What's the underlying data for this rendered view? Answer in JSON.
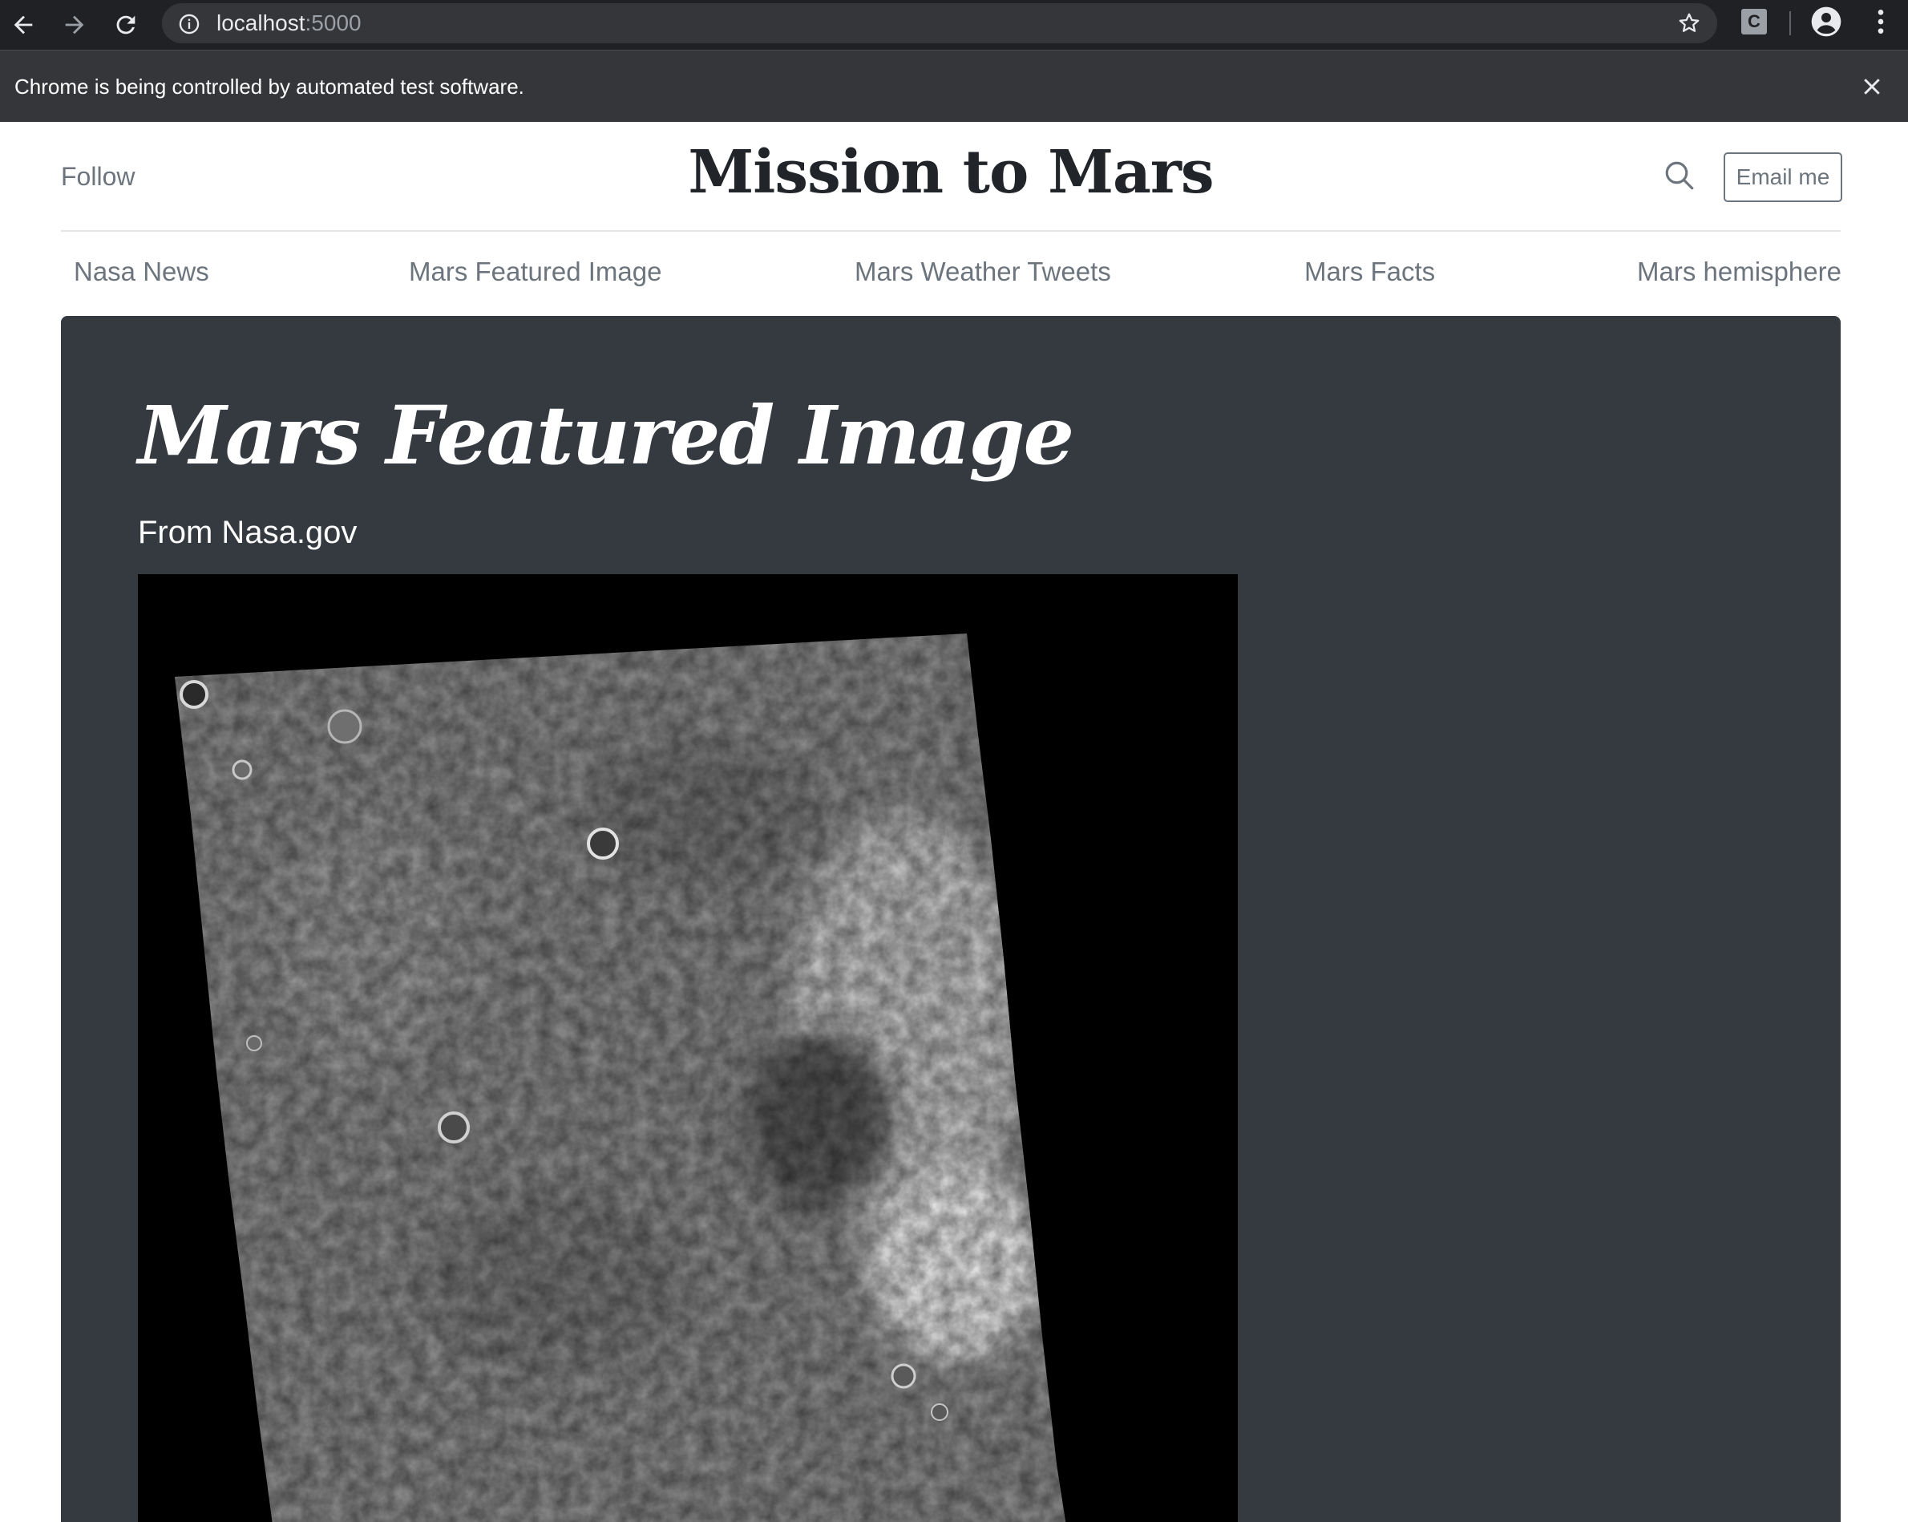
{
  "browser": {
    "url_host": "localhost",
    "url_port": ":5000",
    "extension_letter": "C",
    "infobar_message": "Chrome is being controlled by automated test software."
  },
  "header": {
    "follow": "Follow",
    "title": "Mission to Mars",
    "email_button": "Email me"
  },
  "nav": {
    "items": [
      {
        "label": "Nasa News"
      },
      {
        "label": "Mars Featured Image"
      },
      {
        "label": "Mars Weather Tweets"
      },
      {
        "label": "Mars Facts"
      },
      {
        "label": "Mars hemisphere"
      }
    ]
  },
  "featured": {
    "heading": "Mars Featured Image",
    "subtitle": "From Nasa.gov"
  }
}
